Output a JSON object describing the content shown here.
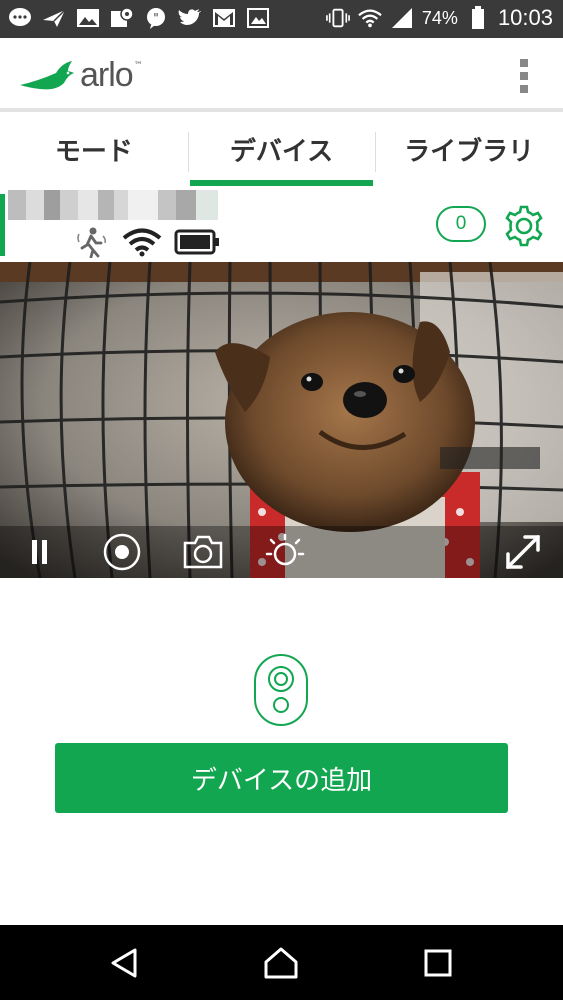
{
  "status_bar": {
    "battery_percent": "74%",
    "time": "10:03",
    "icons_left": [
      "message-icon",
      "send-icon",
      "image-icon",
      "map-icon",
      "chat-bubble-icon",
      "twitter-icon",
      "gmail-icon",
      "photo-icon"
    ],
    "icons_right": [
      "vibrate-icon",
      "wifi-icon",
      "cell-signal-icon",
      "battery-icon"
    ]
  },
  "app_bar": {
    "logo_text": "arlo",
    "logo_tm": "™",
    "menu_icon": "overflow-menu-icon"
  },
  "tabs": [
    {
      "label": "モード",
      "active": false
    },
    {
      "label": "デバイス",
      "active": true
    },
    {
      "label": "ライブラリ",
      "active": false
    }
  ],
  "device": {
    "status_icons": [
      "motion-detection-icon",
      "wifi-signal-icon",
      "battery-icon"
    ],
    "notification_count": "0",
    "settings_icon": "gear-icon"
  },
  "video_controls": [
    "pause-icon",
    "record-icon",
    "snapshot-camera-icon",
    "brightness-icon",
    "fullscreen-icon"
  ],
  "empty_state": {
    "camera_icon": "arlo-camera-icon",
    "add_button_label": "デバイスの追加"
  },
  "nav_bar": [
    "back-icon",
    "home-icon",
    "recents-icon"
  ],
  "colors": {
    "brand_green": "#13a651",
    "status_bar": "#3a3a3a",
    "nav_bar": "#000000"
  }
}
